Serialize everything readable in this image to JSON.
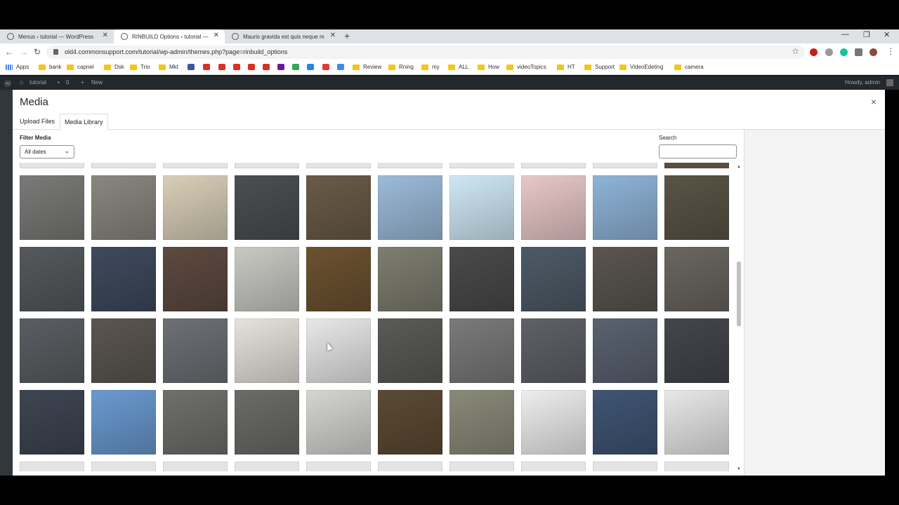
{
  "browser": {
    "tabs": [
      {
        "label": "Menus ‹ tutorial — WordPress",
        "active": false
      },
      {
        "label": "RINBUILD Options ‹ tutorial — W",
        "active": true
      },
      {
        "label": "Mauris gravida est quis neque m",
        "active": false
      }
    ],
    "url": "old4.commonsupport.com/tutorial/wp-admin/themes.php?page=rinbuild_options",
    "bookmarks": [
      "Apps",
      "bank",
      "capnel",
      "Dsk",
      "Trio",
      "Mkt",
      "Review",
      "Rning",
      "my",
      "ALL",
      "How",
      "videoTopics",
      "HT",
      "Support",
      "VideoEdeting",
      "camera"
    ]
  },
  "adminbar": {
    "site": "tutorial",
    "comments": "0",
    "new": "New",
    "howdy": "Howdy, admin"
  },
  "modal": {
    "title": "Media",
    "close": "×",
    "tabs": [
      "Upload Files",
      "Media Library"
    ],
    "filter_label": "Filter Media",
    "date_filter": "All dates",
    "search_label": "Search",
    "search_value": ""
  },
  "colors": {
    "accent": "#0073aa",
    "modal_bg": "#ffffff",
    "adminbar": "#23282d"
  },
  "media_items": [
    [
      "#7a7a78",
      "#8a8780",
      "#d8cfb8",
      "#4b4f52",
      "#6a5b48",
      "#9cbbd9",
      "#cfe8f5",
      "#e8c8c8",
      "#8fb4d8",
      "#5a5446"
    ],
    [
      "#55595c",
      "#3e4a5c",
      "#5d4a40",
      "#c9c9c4",
      "#6b5230",
      "#7d7d70",
      "#4a4a4a",
      "#4d5a66",
      "#5a5550",
      "#6a6660"
    ],
    [
      "#5a5e62",
      "#5b5651",
      "#6d7075",
      "#e6e2dc",
      "#e8e8e8",
      "#5a5a56",
      "#7a7a7a",
      "#5e6167",
      "#5a6270",
      "#44464c"
    ],
    [
      "#3e4552",
      "#6a9ad0",
      "#6f706c",
      "#6b6b68",
      "#d5d5d2",
      "#5c4a33",
      "#8a8a7a",
      "#eeeeee",
      "#3f5574",
      "#e8e8e8"
    ]
  ]
}
